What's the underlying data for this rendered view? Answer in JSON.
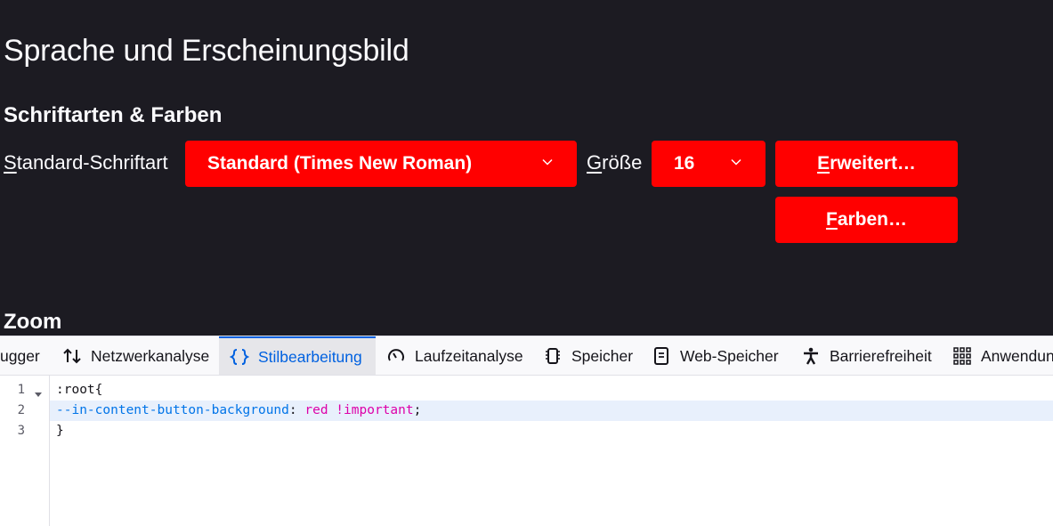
{
  "settings": {
    "page_title": "Sprache und Erscheinungsbild",
    "section_fonts": "Schriftarten & Farben",
    "font_label_accel": "S",
    "font_label_rest": "tandard-Schriftart",
    "font_select_value": "Standard (Times New Roman)",
    "size_label_pre": "G",
    "size_label_accel": "r",
    "size_label_rest": "öße",
    "size_select_value": "16",
    "advanced_accel": "E",
    "advanced_rest": "rweitert…",
    "colors_accel": "F",
    "colors_rest": "arben…",
    "section_zoom": "Zoom",
    "button_color": "#ff0000",
    "background_color": "#1c1b22"
  },
  "devtools": {
    "tabs": [
      {
        "label": "ugger",
        "icon": "debugger-icon"
      },
      {
        "label": "Netzwerkanalyse",
        "icon": "network-arrows-icon"
      },
      {
        "label": "Stilbearbeitung",
        "icon": "braces-icon"
      },
      {
        "label": "Laufzeitanalyse",
        "icon": "gauge-icon"
      },
      {
        "label": "Speicher",
        "icon": "memory-chip-icon"
      },
      {
        "label": "Web-Speicher",
        "icon": "storage-icon"
      },
      {
        "label": "Barrierefreiheit",
        "icon": "accessibility-person-icon"
      },
      {
        "label": "Anwendung",
        "icon": "grid-apps-icon"
      }
    ],
    "selected_tab": "Stilbearbeitung",
    "code": {
      "line_numbers": [
        "1",
        "2",
        "3"
      ],
      "line1": ":root{",
      "line2_prop": "--in-content-button-background",
      "line2_colon": ": ",
      "line2_value": "red !important",
      "line2_semi": ";",
      "line3": "}"
    }
  }
}
